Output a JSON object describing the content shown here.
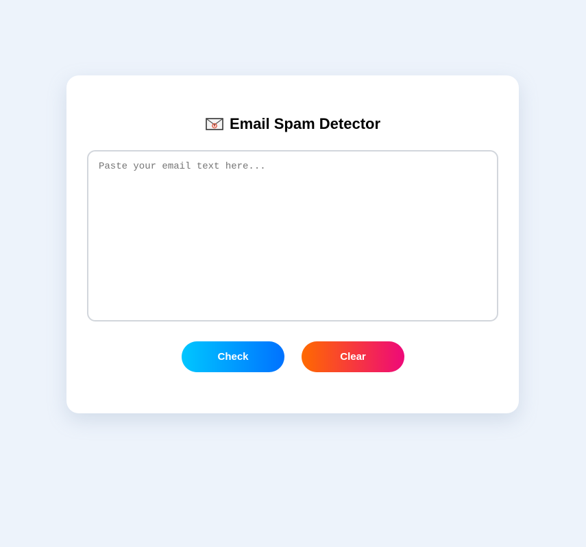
{
  "app": {
    "title_icon": "email-envelope-icon",
    "title": "Email Spam Detector"
  },
  "email_input": {
    "value": "",
    "placeholder": "Paste your email text here..."
  },
  "buttons": {
    "check_label": "Check",
    "clear_label": "Clear"
  },
  "colors": {
    "page_background": "#edf3fb",
    "card_background": "#ffffff",
    "check_gradient": [
      "#00c6ff",
      "#0072ff"
    ],
    "clear_gradient": [
      "#ff6a00",
      "#ee0979"
    ]
  }
}
